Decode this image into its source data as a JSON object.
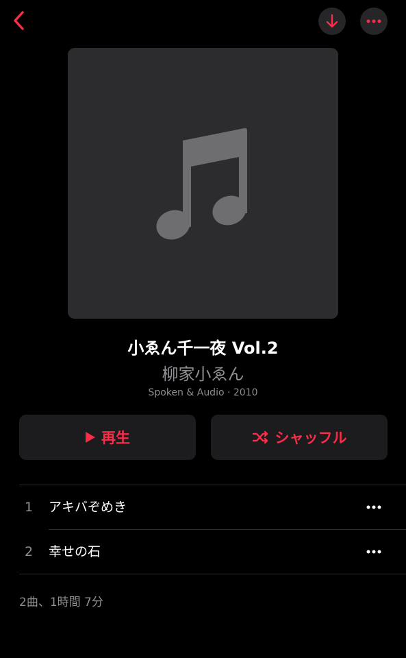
{
  "colors": {
    "accent": "#fa2d48",
    "background": "#000000",
    "button_background": "#1c1c1e",
    "artwork_background": "#2c2c2e",
    "secondary_text": "#8e8e93"
  },
  "nav": {
    "back_icon": "chevron-left-icon",
    "download_icon": "arrow-down-icon",
    "more_icon": "ellipsis-icon"
  },
  "album": {
    "artwork_icon": "music-note-icon",
    "title": "小ゑん千一夜 Vol.2",
    "artist": "柳家小ゑん",
    "meta": "Spoken & Audio · 2010"
  },
  "actions": {
    "play_label": "再生",
    "play_icon": "play-icon",
    "shuffle_label": "シャッフル",
    "shuffle_icon": "shuffle-icon"
  },
  "tracks": [
    {
      "number": "1",
      "title": "アキバぞめき"
    },
    {
      "number": "2",
      "title": "幸せの石"
    }
  ],
  "summary": "2曲、1時間 7分"
}
